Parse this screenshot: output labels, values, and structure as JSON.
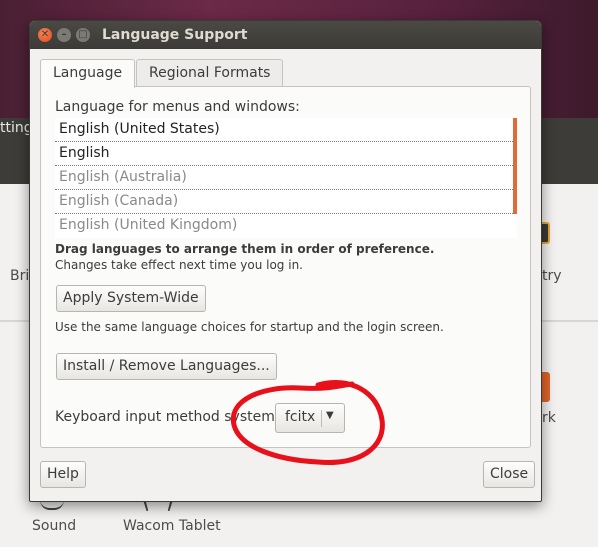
{
  "background": {
    "bar_text": "tting",
    "labels": {
      "bri": "Bri",
      "try": "try",
      "rk": "rk",
      "sound": "Sound",
      "wacom": "Wacom Tablet"
    }
  },
  "dialog": {
    "title": "Language Support",
    "window_buttons": {
      "close": "✕",
      "minimize": "–",
      "maximize": "□"
    },
    "tabs": [
      {
        "label": "Language",
        "active": true
      },
      {
        "label": "Regional Formats",
        "active": false
      }
    ],
    "language_section_label": "Language for menus and windows:",
    "languages": [
      {
        "name": "English (United States)",
        "enabled": true
      },
      {
        "name": "English",
        "enabled": true
      },
      {
        "name": "English (Australia)",
        "enabled": false
      },
      {
        "name": "English (Canada)",
        "enabled": false
      },
      {
        "name": "English (United Kingdom)",
        "enabled": false
      }
    ],
    "drag_hint": "Drag languages to arrange them in order of preference.",
    "changes_hint": "Changes take effect next time you log in.",
    "apply_button": "Apply System-Wide",
    "apply_hint": "Use the same language choices for startup and the login screen.",
    "install_button": "Install / Remove Languages...",
    "keyboard_label": "Keyboard input method system:",
    "keyboard_value": "fcitx",
    "help_button": "Help",
    "close_button": "Close"
  },
  "colors": {
    "accent_scrollbar": "#e06b3a",
    "annotation": "#e8111b",
    "titlebar": "#3c3b37",
    "close_button": "#df4a1c"
  },
  "icons": {
    "dropdown": "chevron-down-icon",
    "close": "close-icon",
    "minimize": "minimize-icon",
    "maximize": "maximize-icon"
  }
}
